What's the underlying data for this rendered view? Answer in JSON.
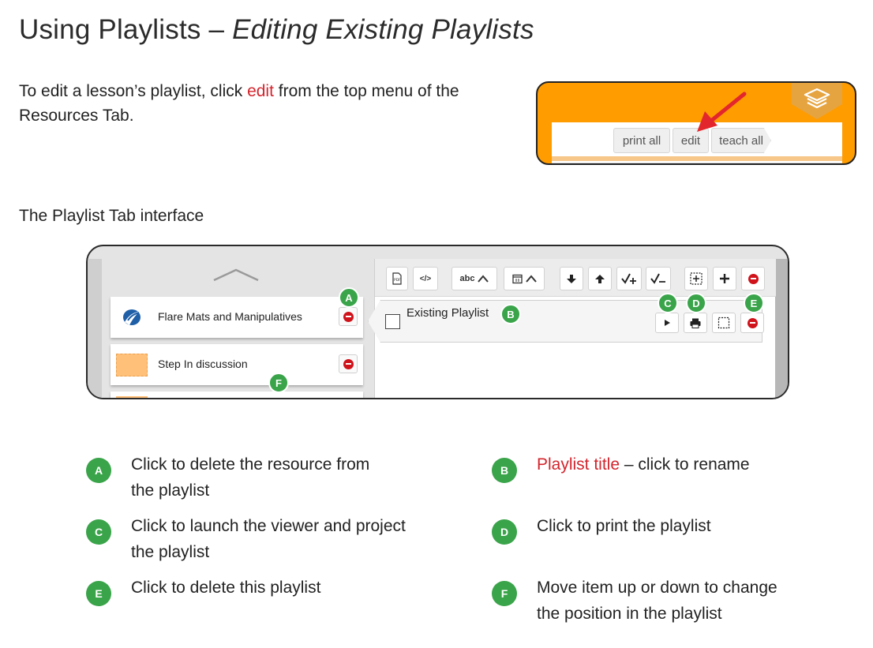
{
  "title": {
    "main": "Using Playlists – ",
    "italic": "Editing Existing Playlists"
  },
  "intro": {
    "before": "To edit a lesson’s playlist, click ",
    "link": "edit",
    "after_line1": " from the top menu of the",
    "line2": "Resources Tab."
  },
  "snippet": {
    "buttons": [
      "print all",
      "edit",
      "teach all"
    ],
    "accent_color": "#ff9c00"
  },
  "subheading": "The Playlist Tab interface",
  "playlist_ui": {
    "toolbar": {
      "pdf": "PDF",
      "embed": "</>",
      "abc": "abc",
      "icons": [
        "pdf-icon",
        "embed-code-icon",
        "text-sort-icon",
        "calendar-sort-icon",
        "move-down-icon",
        "move-up-icon",
        "check-plus-icon",
        "check-minus-icon",
        "select-box-icon",
        "add-icon",
        "delete-icon"
      ]
    },
    "resources": [
      {
        "label": "Flare Mats and Manipulatives"
      },
      {
        "label": "Step In discussion"
      }
    ],
    "playlist_title": "Existing Playlist",
    "badges": {
      "a": "A",
      "b": "B",
      "c": "C",
      "d": "D",
      "e": "E",
      "f": "F"
    }
  },
  "legend": {
    "a": {
      "letter": "A",
      "line1": "Click to delete the resource from",
      "line2": "the playlist"
    },
    "b": {
      "letter": "B",
      "red": "Playlist title",
      "rest": " – click to rename"
    },
    "c": {
      "letter": "C",
      "line1": "Click to launch the viewer and project",
      "line2": "the playlist"
    },
    "d": {
      "letter": "D",
      "line1": "Click to print the playlist"
    },
    "e": {
      "letter": "E",
      "line1": "Click to delete this playlist"
    },
    "f": {
      "letter": "F",
      "line1": "Move item up or down to change",
      "line2": "the position in the playlist"
    }
  },
  "colors": {
    "link_red": "#d3242c",
    "badge_green": "#3aa44a",
    "delete_red": "#d0121b"
  }
}
